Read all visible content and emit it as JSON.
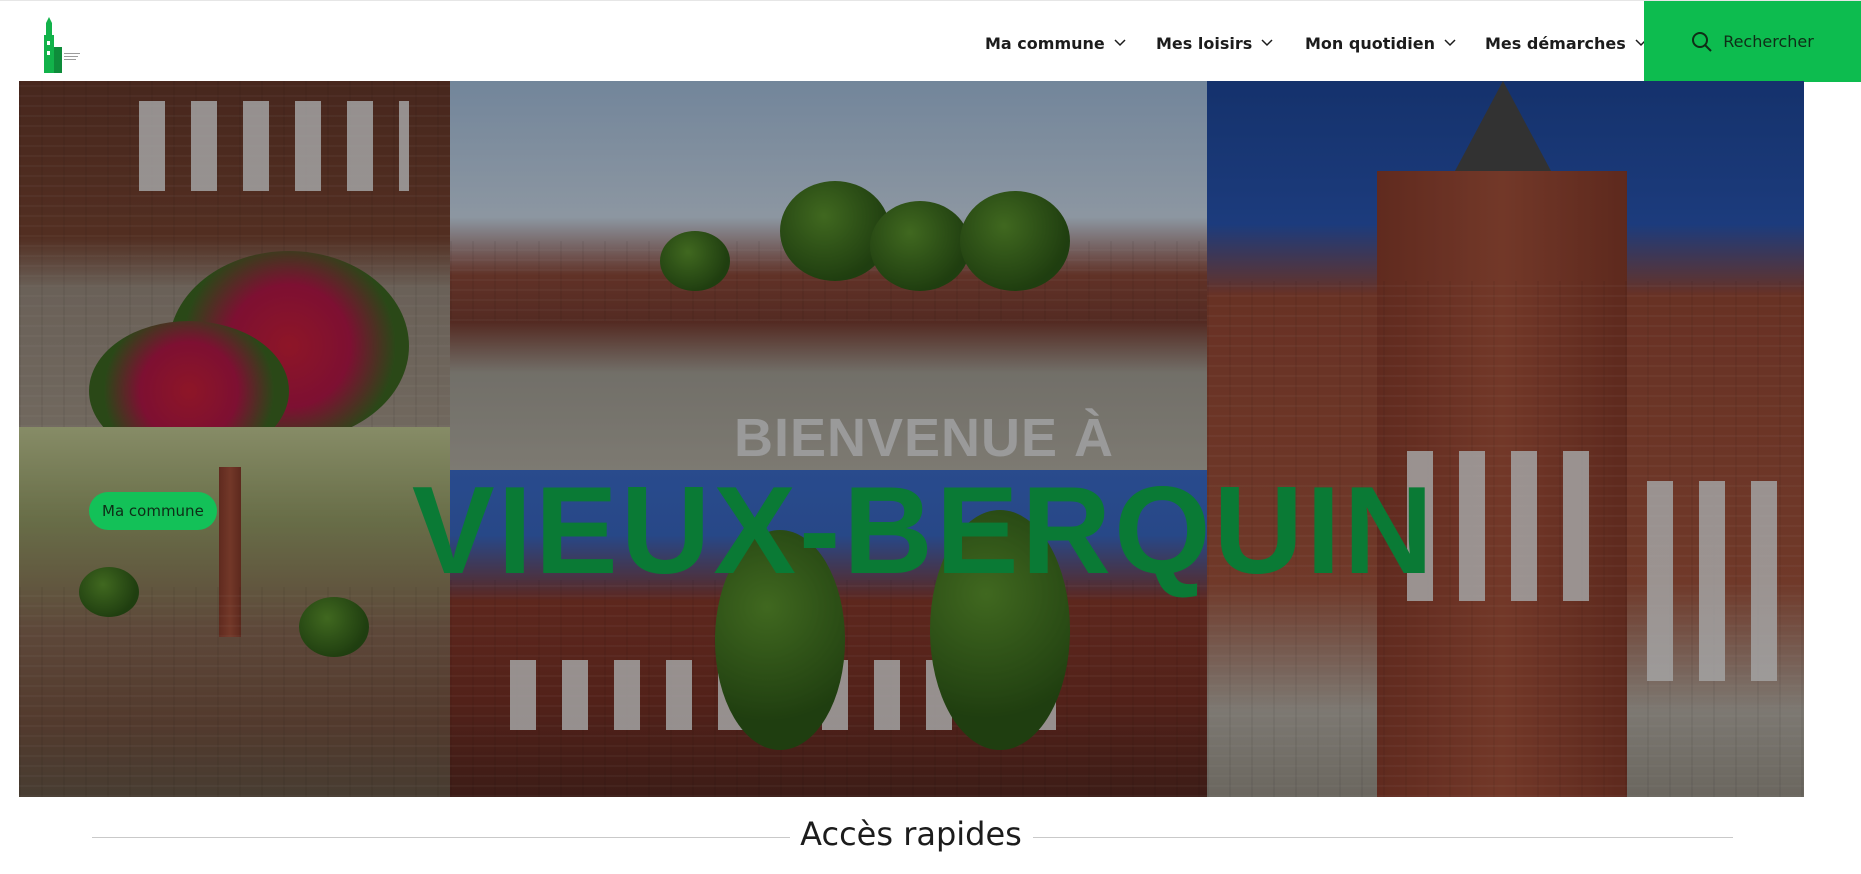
{
  "header": {
    "logo_icon": "town-logo-icon",
    "nav": [
      {
        "label": "Ma commune"
      },
      {
        "label": "Mes loisirs"
      },
      {
        "label": "Mon quotidien"
      },
      {
        "label": "Mes démarches"
      }
    ],
    "search_label": "Rechercher",
    "brand_color": "#0dbc4f"
  },
  "hero": {
    "subtitle": "BIENVENUE À",
    "title": "VIEUX-BERQUIN",
    "badge": "Ma commune",
    "title_color": "#0a7a35"
  },
  "quick_access": {
    "title": "Accès rapides"
  }
}
